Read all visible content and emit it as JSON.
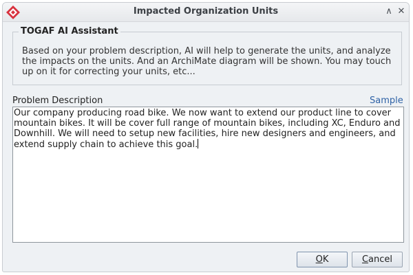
{
  "window": {
    "title": "Impacted Organization Units",
    "minimize_glyph": "∧",
    "close_glyph": "✕",
    "app_icon": "diamond-logo-icon",
    "accent_color": "#d8323f"
  },
  "assistant": {
    "title": "TOGAF AI Assistant",
    "description": "Based on your problem description, AI will help to generate the units, and analyze the impacts on the units. And an ArchiMate diagram will be shown. You may touch up on it for correcting your units, etc..."
  },
  "problem": {
    "label": "Problem Description",
    "sample_link": "Sample",
    "text": "Our company producing road bike. We now want to extend our product line to cover mountain bikes. It will be cover full range of mountain bikes, including XC, Enduro and Downhill. We will need to setup new facilities, hire new designers and engineers, and extend supply chain to achieve this goal."
  },
  "buttons": {
    "ok_mnemonic": "O",
    "ok_rest": "K",
    "cancel_mnemonic": "C",
    "cancel_rest": "ancel"
  }
}
